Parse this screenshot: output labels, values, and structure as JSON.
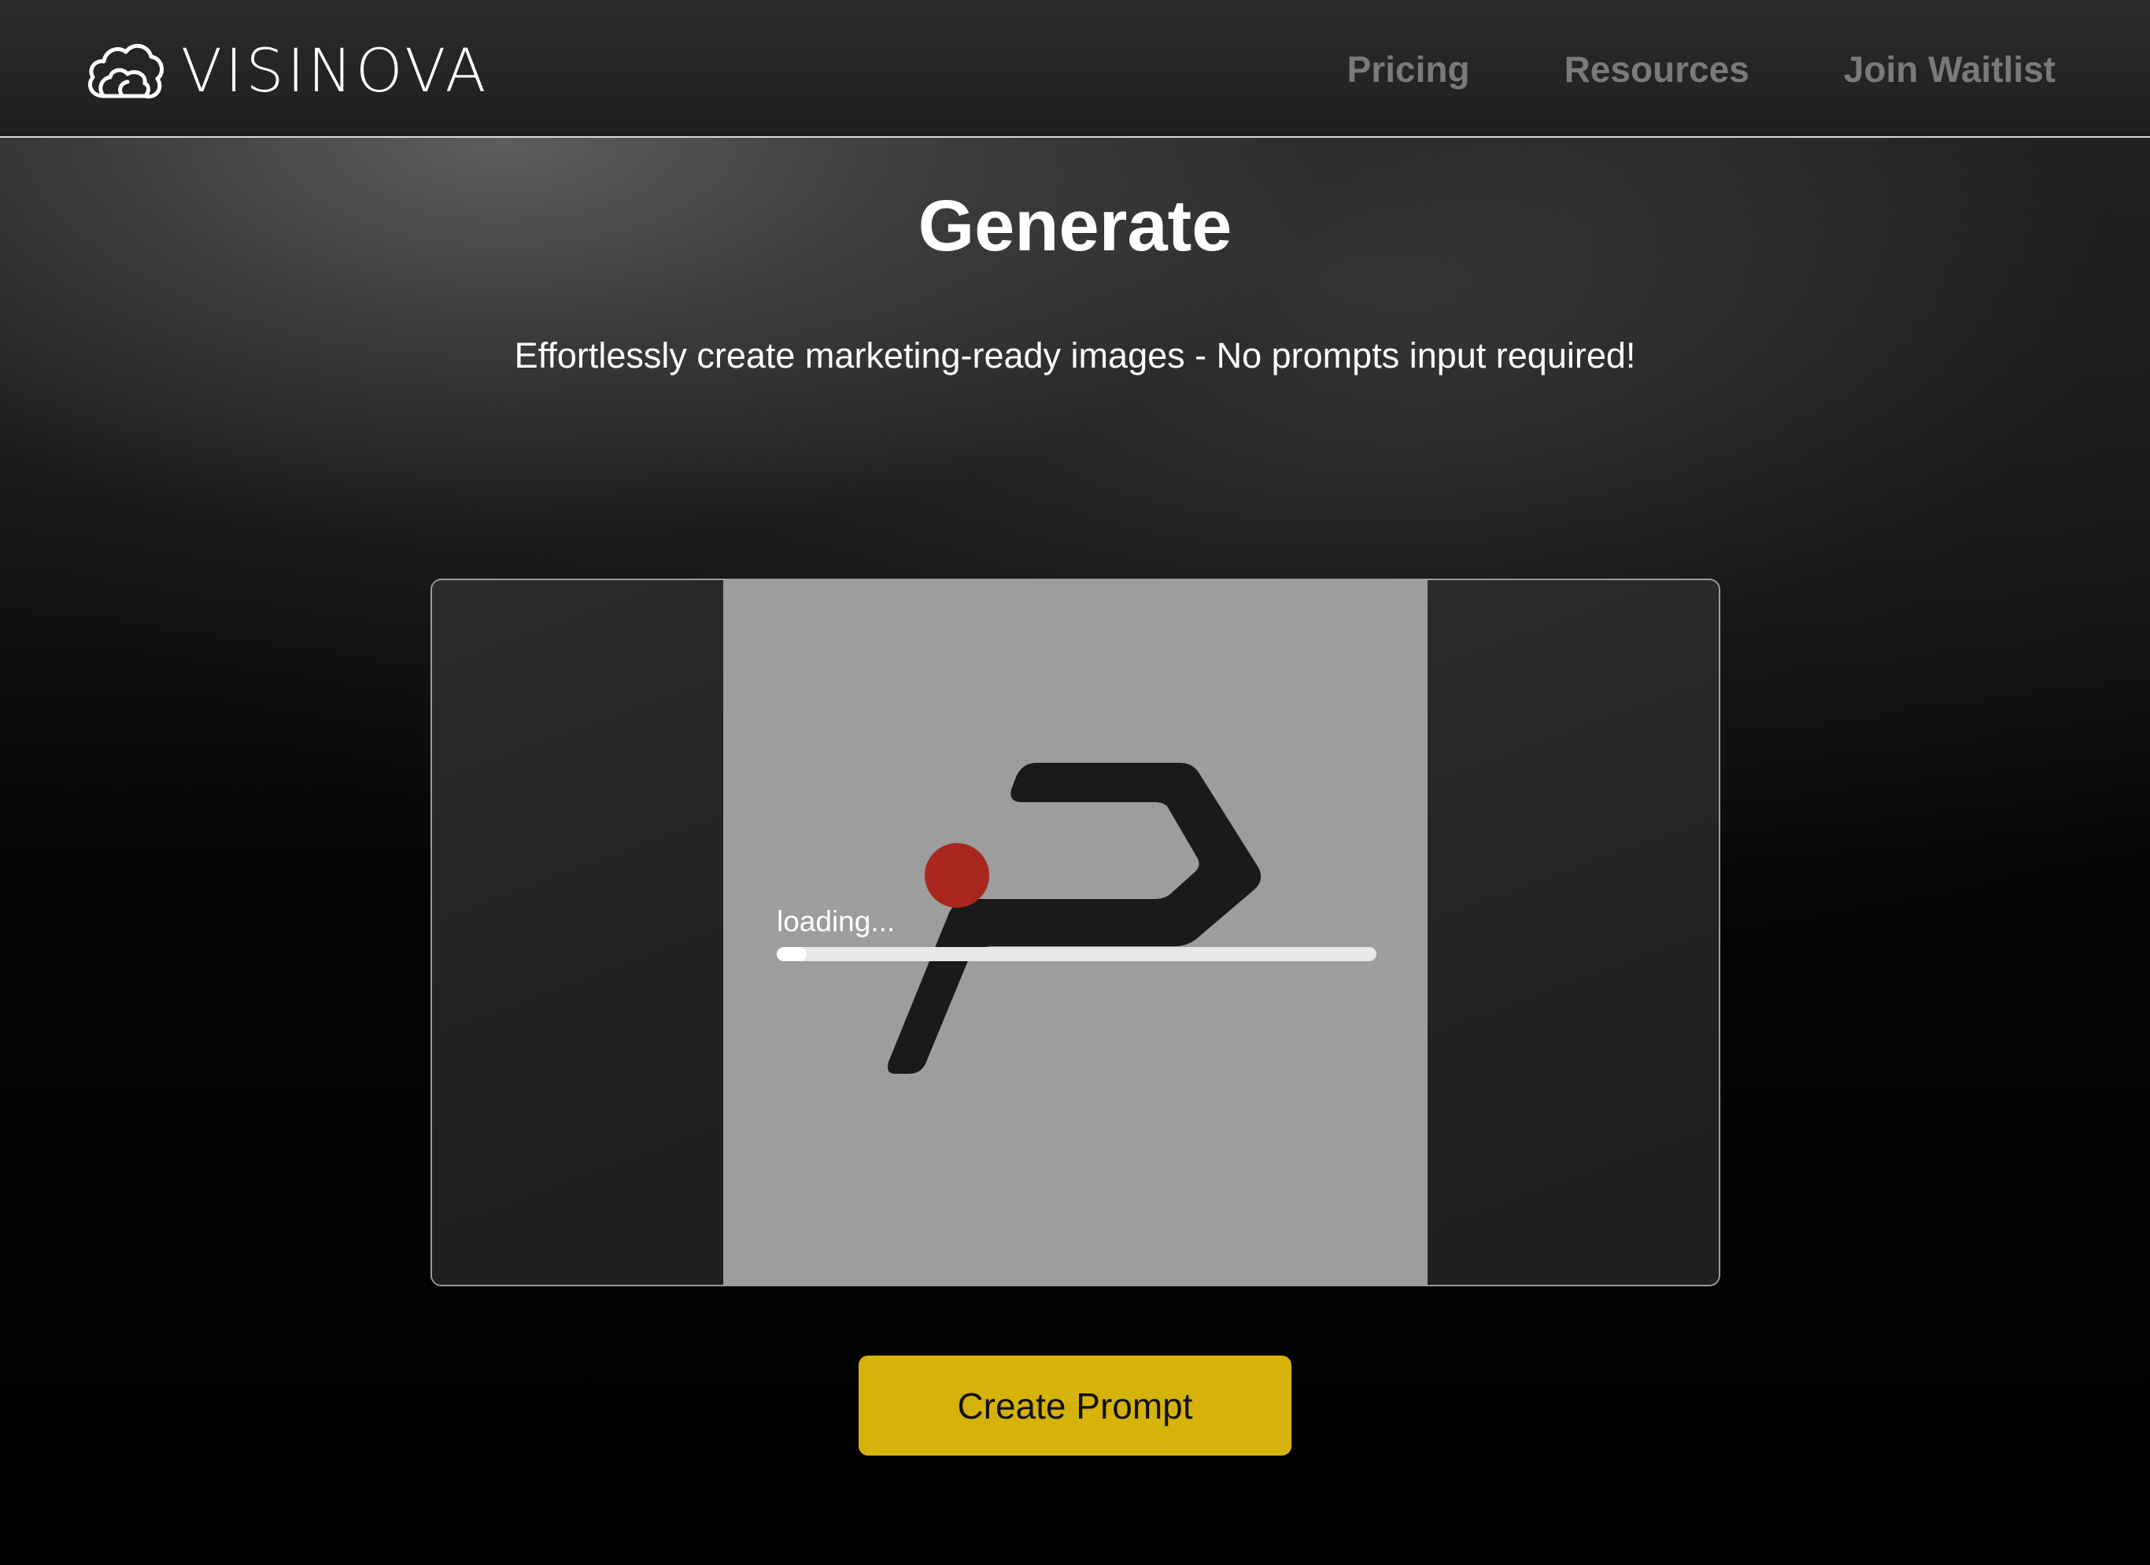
{
  "header": {
    "brand": "VISINOVA",
    "logo_icon": "cloud-icon",
    "nav": [
      {
        "label": "Pricing"
      },
      {
        "label": "Resources"
      },
      {
        "label": "Join Waitlist"
      }
    ]
  },
  "main": {
    "title": "Generate",
    "subtitle": "Effortlessly create marketing-ready images - No prompts input required!"
  },
  "preview": {
    "loading_label": "loading...",
    "progress_percent": 5,
    "mark_icon": "p-logo-mark-icon",
    "dot_icon": "red-dot-icon",
    "colors": {
      "canvas": "#9d9d9d",
      "mark": "#1a1a1a",
      "dot": "#a8281e"
    }
  },
  "cta": {
    "label": "Create Prompt",
    "color": "#d6b30a"
  }
}
